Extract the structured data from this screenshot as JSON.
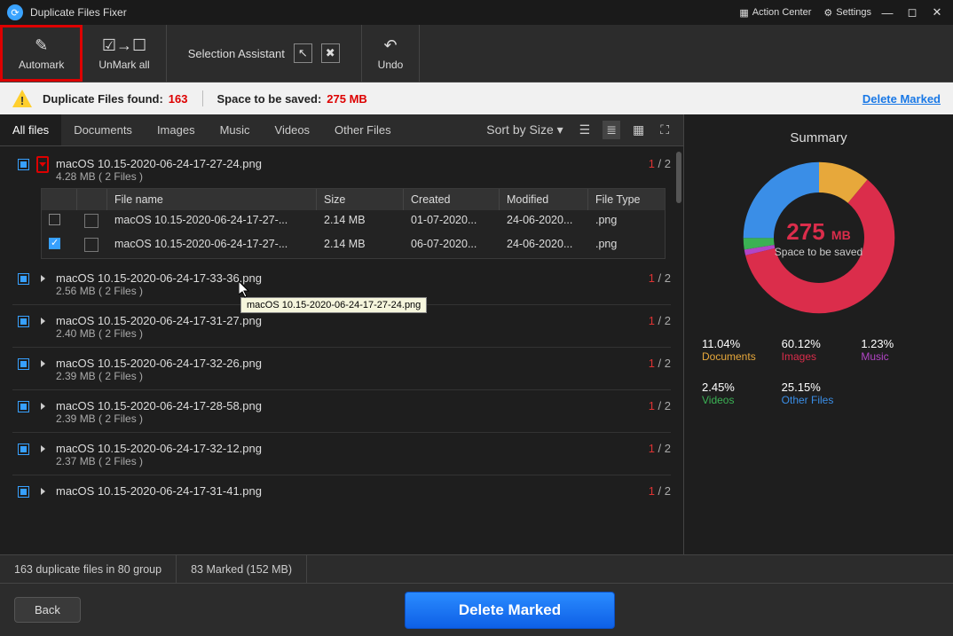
{
  "titlebar": {
    "title": "Duplicate Files Fixer",
    "action_center": "Action Center",
    "settings": "Settings"
  },
  "toolbar": {
    "automark": "Automark",
    "unmark": "UnMark all",
    "selection_assistant": "Selection Assistant",
    "undo": "Undo"
  },
  "infobar": {
    "found_label": "Duplicate Files found:",
    "found_value": "163",
    "space_label": "Space to be saved:",
    "space_value": "275 MB",
    "delete_marked": "Delete Marked"
  },
  "tabs": {
    "all": "All files",
    "documents": "Documents",
    "images": "Images",
    "music": "Music",
    "videos": "Videos",
    "other": "Other Files",
    "sort": "Sort by Size"
  },
  "expanded": {
    "headers": {
      "name": "File name",
      "size": "Size",
      "created": "Created",
      "modified": "Modified",
      "type": "File Type"
    },
    "rows": [
      {
        "checked": false,
        "name": "macOS 10.15-2020-06-24-17-27-...",
        "size": "2.14 MB",
        "created": "01-07-2020...",
        "modified": "24-06-2020...",
        "type": ".png"
      },
      {
        "checked": true,
        "name": "macOS 10.15-2020-06-24-17-27-...",
        "size": "2.14 MB",
        "created": "06-07-2020...",
        "modified": "24-06-2020...",
        "type": ".png"
      }
    ]
  },
  "tooltip": "macOS 10.15-2020-06-24-17-27-24.png",
  "groups": [
    {
      "name": "macOS 10.15-2020-06-24-17-27-24.png",
      "sub": "4.28 MB  ( 2 Files )",
      "marked": "1",
      "total": "2",
      "expanded": true
    },
    {
      "name": "macOS 10.15-2020-06-24-17-33-36.png",
      "sub": "2.56 MB  ( 2 Files )",
      "marked": "1",
      "total": "2"
    },
    {
      "name": "macOS 10.15-2020-06-24-17-31-27.png",
      "sub": "2.40 MB  ( 2 Files )",
      "marked": "1",
      "total": "2"
    },
    {
      "name": "macOS 10.15-2020-06-24-17-32-26.png",
      "sub": "2.39 MB  ( 2 Files )",
      "marked": "1",
      "total": "2"
    },
    {
      "name": "macOS 10.15-2020-06-24-17-28-58.png",
      "sub": "2.39 MB  ( 2 Files )",
      "marked": "1",
      "total": "2"
    },
    {
      "name": "macOS 10.15-2020-06-24-17-32-12.png",
      "sub": "2.37 MB  ( 2 Files )",
      "marked": "1",
      "total": "2"
    },
    {
      "name": "macOS 10.15-2020-06-24-17-31-41.png",
      "sub": "",
      "marked": "1",
      "total": "2"
    }
  ],
  "summary": {
    "title": "Summary",
    "donut_value": "275",
    "donut_unit": "MB",
    "donut_sub": "Space to be\nsaved",
    "stats": [
      {
        "pct": "11.04%",
        "label": "Documents",
        "cls": "c-doc"
      },
      {
        "pct": "60.12%",
        "label": "Images",
        "cls": "c-img"
      },
      {
        "pct": "1.23%",
        "label": "Music",
        "cls": "c-mus"
      },
      {
        "pct": "2.45%",
        "label": "Videos",
        "cls": "c-vid"
      },
      {
        "pct": "25.15%",
        "label": "Other Files",
        "cls": "c-oth"
      }
    ]
  },
  "chart_data": {
    "type": "pie",
    "title": "Space to be saved — 275 MB",
    "series": [
      {
        "name": "Documents",
        "value": 11.04,
        "color": "#e7a83b"
      },
      {
        "name": "Images",
        "value": 60.12,
        "color": "#db2d4b"
      },
      {
        "name": "Music",
        "value": 1.23,
        "color": "#b245c6"
      },
      {
        "name": "Videos",
        "value": 2.45,
        "color": "#3bb154"
      },
      {
        "name": "Other Files",
        "value": 25.15,
        "color": "#3a8ee7"
      }
    ]
  },
  "statusbar": {
    "left": "163 duplicate files in 80 group",
    "right": "83 Marked (152 MB)"
  },
  "bottom": {
    "back": "Back",
    "delete": "Delete Marked"
  }
}
